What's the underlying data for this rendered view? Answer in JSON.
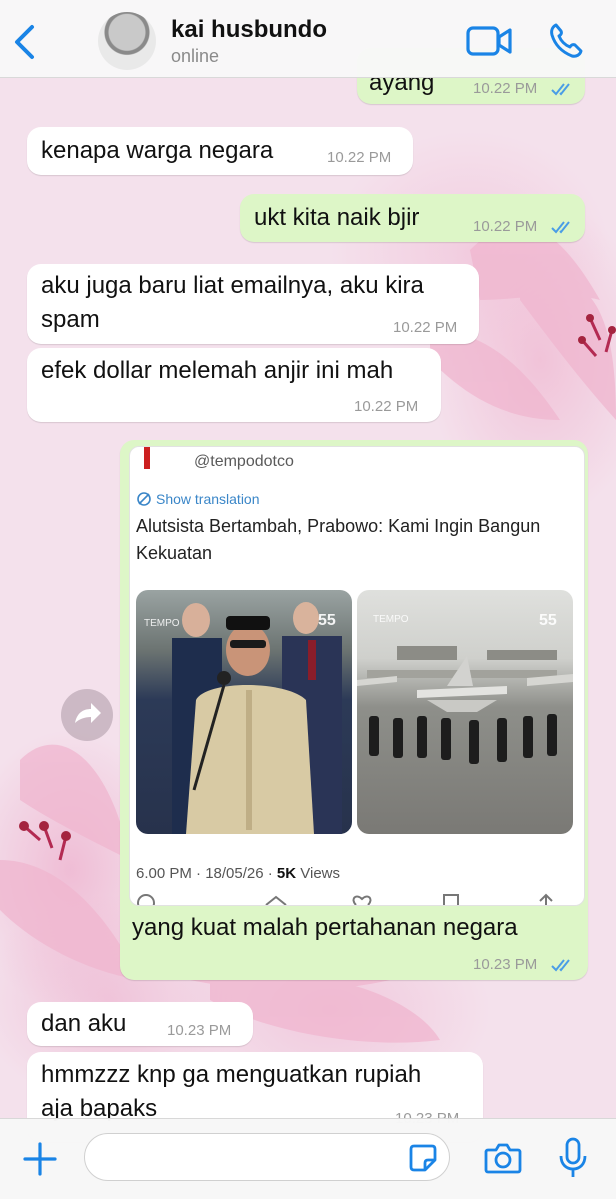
{
  "header": {
    "contact_name": "kai husbundo",
    "status": "online",
    "back_icon": "chevron-left-icon",
    "video_icon": "video-camera-icon",
    "phone_icon": "phone-icon"
  },
  "colors": {
    "accent": "#1a84e6",
    "outgoing_bubble": "#ddf6c7",
    "incoming_bubble": "#ffffff",
    "read_ticks": "#4a9de6"
  },
  "messages": [
    {
      "direction": "out",
      "text": "ayang",
      "time": "10.22 PM",
      "read": true
    },
    {
      "direction": "in",
      "text": "kenapa warga negara",
      "time": "10.22 PM"
    },
    {
      "direction": "out",
      "text": "ukt kita naik bjir",
      "time": "10.22 PM",
      "read": true
    },
    {
      "direction": "in",
      "text_line1": "aku juga baru liat emailnya, aku kira",
      "text_line2": "spam",
      "time": "10.22 PM"
    },
    {
      "direction": "in",
      "text": "efek dollar melemah anjir ini mah",
      "time": "10.22 PM"
    },
    {
      "direction": "out",
      "text": "yang kuat malah pertahanan negara",
      "time": "10.23 PM",
      "read": true
    },
    {
      "direction": "in",
      "text": "dan aku",
      "time": "10.23 PM"
    },
    {
      "direction": "in",
      "text_line1": "hmmzzz knp ga menguatkan rupiah",
      "text_line2": "aja bapaks",
      "time": "10.23 PM"
    }
  ],
  "link_card": {
    "handle": "@tempodotco",
    "translate_label": "Show translation",
    "title": "Alutsista Bertambah, Prabowo: Kami Ingin Bangun Kekuatan",
    "watermark": "TEMPO",
    "watermark_num": "55",
    "meta_time": "6.00 PM · 18/05/26 · ",
    "meta_views_count": "5K",
    "meta_views_label": " Views"
  },
  "input_bar": {
    "placeholder": "",
    "icons": [
      "plus-icon",
      "sticker-icon",
      "camera-icon",
      "microphone-icon"
    ]
  }
}
